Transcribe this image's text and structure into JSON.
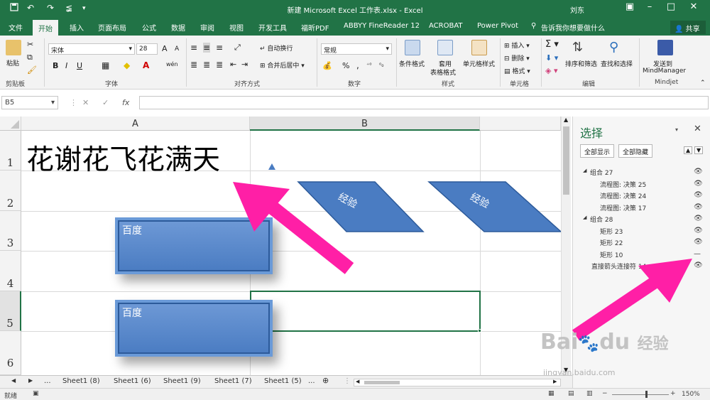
{
  "window": {
    "title": "新建 Microsoft Excel 工作表.xlsx  -  Excel",
    "user": "刘东",
    "quick_access": {
      "save_icon": "save-icon",
      "undo_icon": "undo-icon",
      "redo_icon": "redo-icon",
      "custom_icon": "format-painter-icon"
    }
  },
  "tabs": [
    "文件",
    "开始",
    "插入",
    "页面布局",
    "公式",
    "数据",
    "审阅",
    "视图",
    "开发工具",
    "福昕PDF",
    "ABBYY FineReader 12",
    "ACROBAT",
    "Power Pivot",
    "告诉我你想要做什么"
  ],
  "active_tab": "开始",
  "share_label": "共享",
  "ribbon": {
    "clipboard": {
      "paste": "粘贴",
      "group": "剪贴板"
    },
    "font": {
      "name": "宋体",
      "size": "28",
      "grow": "A",
      "shrink": "A",
      "bold": "B",
      "italic": "I",
      "underline": "U",
      "phonetic": "wén",
      "group": "字体"
    },
    "align": {
      "wrap": "自动换行",
      "merge": "合并后居中",
      "group": "对齐方式"
    },
    "number": {
      "format": "常规",
      "percent": "%",
      "comma": ",",
      "group": "数字"
    },
    "styles": {
      "conditional": "条件格式",
      "table_line1": "套用",
      "table_line2": "表格格式",
      "cell_styles": "单元格样式",
      "group": "样式"
    },
    "cells": {
      "insert": "插入",
      "delete": "删除",
      "format": "格式",
      "group": "单元格"
    },
    "editing": {
      "sort": "排序和筛选",
      "find": "查找和选择",
      "group": "编辑"
    },
    "mindjet": {
      "send_line1": "发送到",
      "send_line2": "MindManager",
      "group": "Mindjet"
    }
  },
  "formula_bar": {
    "name_box": "B5",
    "fx": "fx",
    "cancel": "✕",
    "confirm": "✓",
    "value": ""
  },
  "sheet": {
    "columns": [
      "A",
      "B"
    ],
    "rows": [
      "1",
      "2",
      "3",
      "4",
      "5",
      "6"
    ],
    "cell_A1": "花谢花飞花满天",
    "shapes": {
      "rect_top": "百度",
      "rect_bottom": "百度",
      "decision_left": "经验",
      "decision_right": "经验"
    },
    "arrow_color": "#ff1fa6",
    "shape_color": "#4a7cc2"
  },
  "selection_pane": {
    "title": "选择",
    "show_all": "全部显示",
    "hide_all": "全部隐藏",
    "items": [
      {
        "label": "组合 27",
        "level": 0,
        "visible": "on"
      },
      {
        "label": "流程图: 决策 25",
        "level": 1,
        "visible": "on"
      },
      {
        "label": "流程图: 决策 24",
        "level": 1,
        "visible": "on"
      },
      {
        "label": "流程图: 决策 17",
        "level": 1,
        "visible": "on"
      },
      {
        "label": "组合 28",
        "level": 0,
        "visible": "on"
      },
      {
        "label": "矩形 23",
        "level": 1,
        "visible": "on"
      },
      {
        "label": "矩形 22",
        "level": 1,
        "visible": "on"
      },
      {
        "label": "矩形 10",
        "level": 1,
        "visible": "off"
      },
      {
        "label": "直接箭头连接符 14",
        "level": -1,
        "visible": "on"
      }
    ]
  },
  "sheet_tabs": [
    "Sheet1 (8)",
    "Sheet1 (6)",
    "Sheet1 (9)",
    "Sheet1 (7)",
    "Sheet1 (5)"
  ],
  "status": {
    "ready": "就绪",
    "zoom": "150%"
  },
  "watermark": {
    "brand": "Bai",
    "brand2": "du",
    "text": "经验",
    "url": "jingyan.baidu.com"
  }
}
